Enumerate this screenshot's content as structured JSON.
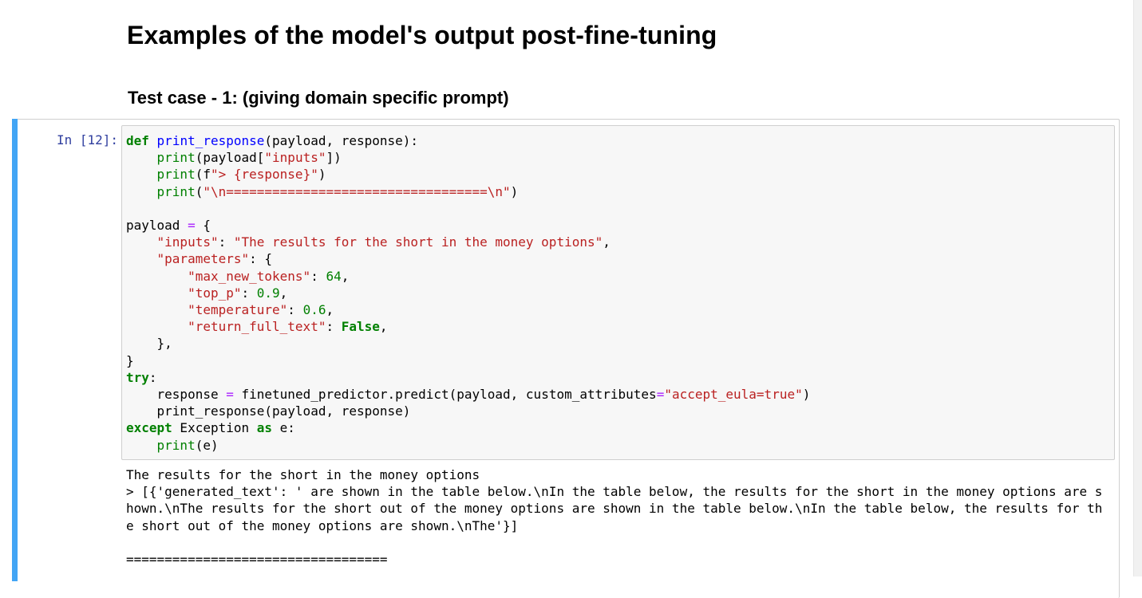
{
  "markdown": {
    "heading": "Examples of the model's output post-fine-tuning",
    "subheading": "Test case - 1: (giving domain specific prompt)"
  },
  "cell": {
    "prompt": "In [12]:",
    "code_lines": [
      "def print_response(payload, response):",
      "    print(payload[\"inputs\"])",
      "    print(f\"> {response}\")",
      "    print(\"\\n==================================\\n\")",
      "",
      "payload = {",
      "    \"inputs\": \"The results for the short in the money options\",",
      "    \"parameters\": {",
      "        \"max_new_tokens\": 64,",
      "        \"top_p\": 0.9,",
      "        \"temperature\": 0.6,",
      "        \"return_full_text\": False,",
      "    },",
      "}",
      "try:",
      "    response = finetuned_predictor.predict(payload, custom_attributes=\"accept_eula=true\")",
      "    print_response(payload, response)",
      "except Exception as e:",
      "    print(e)"
    ],
    "output_lines": [
      "The results for the short in the money options",
      "> [{'generated_text': ' are shown in the table below.\\nIn the table below, the results for the short in the money options are shown.\\nThe results for the short out of the money options are shown in the table below.\\nIn the table below, the results for the short out of the money options are shown.\\nThe'}]",
      "",
      "=================================="
    ]
  },
  "colors": {
    "keyword": "#008000",
    "string": "#ba2121",
    "function_name": "#0000ff",
    "prompt": "#303f9f",
    "cell_selected_bar": "#42a5f5"
  }
}
